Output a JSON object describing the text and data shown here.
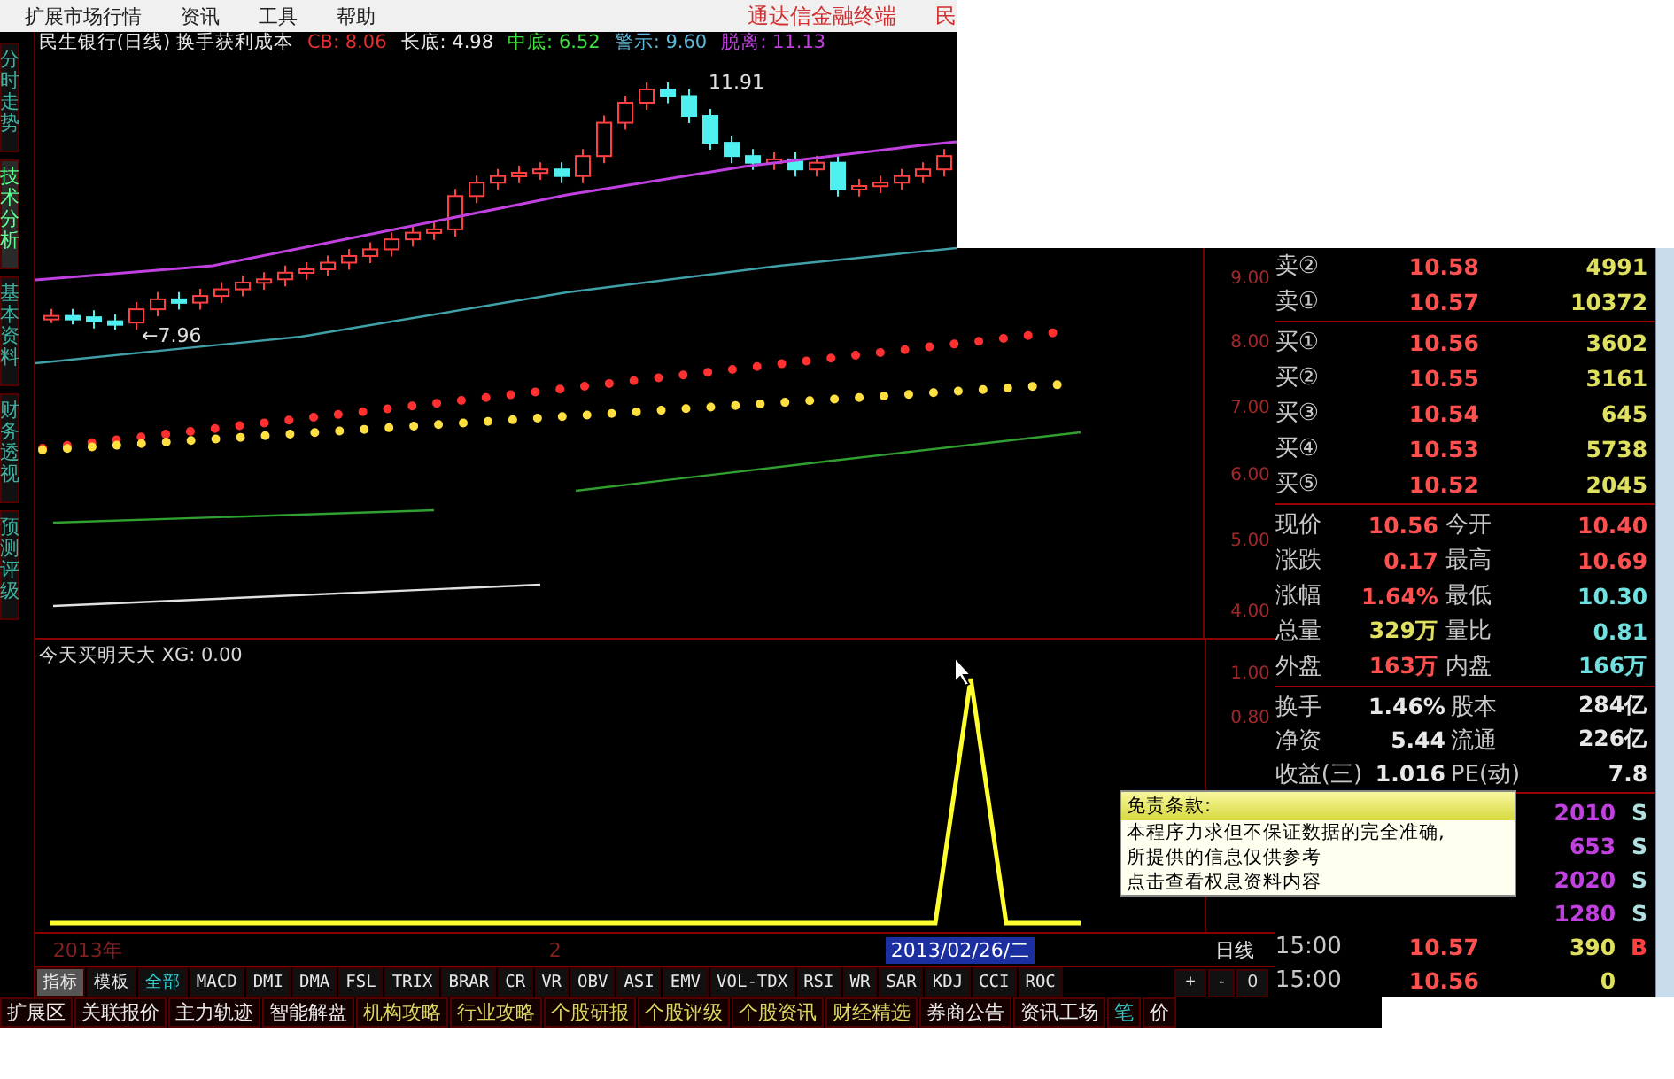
{
  "menu_bar": {
    "items": [
      "扩展市场行情",
      "资讯",
      "工具",
      "帮助"
    ],
    "brand": "通达信金融终端",
    "brand_cut": "民"
  },
  "side_tabs": [
    {
      "label": "分时走势",
      "selected": false
    },
    {
      "label": "技术分析",
      "selected": true
    },
    {
      "label": "基本资料",
      "selected": false
    },
    {
      "label": "财务透视",
      "selected": false
    },
    {
      "label": "预测评级",
      "selected": false
    }
  ],
  "chart_header": {
    "title": "民生银行(日线) 换手获利成本",
    "indicators": [
      {
        "label": "CB:",
        "value": "8.06",
        "kind": "cost"
      },
      {
        "label": "长底:",
        "value": "4.98",
        "kind": "long"
      },
      {
        "label": "中底:",
        "value": "6.52",
        "kind": "mid"
      },
      {
        "label": "警示:",
        "value": "9.60",
        "kind": "warn"
      },
      {
        "label": "脱离:",
        "value": "11.13",
        "kind": "break"
      }
    ]
  },
  "main_chart": {
    "high_marker": "11.91",
    "low_marker": "←7.96",
    "axis_labels": [
      "9.00",
      "8.00",
      "7.00",
      "6.00",
      "5.00",
      "4.00"
    ]
  },
  "lower_panel": {
    "title": "今天买明天大 XG: 0.00",
    "axis_labels": [
      "1.00",
      "0.80"
    ]
  },
  "date_bar": {
    "year": "2013年",
    "month": "2",
    "cursor_date": "2013/02/26/二",
    "period": "日线"
  },
  "indicator_tabs": [
    {
      "label": "指标",
      "selected": true,
      "kind": "mode"
    },
    {
      "label": "模板",
      "selected": false,
      "kind": "mode"
    },
    {
      "label": "全部",
      "selected": false,
      "kind": "group"
    },
    {
      "label": "MACD",
      "selected": false,
      "kind": "indicator"
    },
    {
      "label": "DMI",
      "selected": false,
      "kind": "indicator"
    },
    {
      "label": "DMA",
      "selected": false,
      "kind": "indicator"
    },
    {
      "label": "FSL",
      "selected": false,
      "kind": "indicator"
    },
    {
      "label": "TRIX",
      "selected": false,
      "kind": "indicator"
    },
    {
      "label": "BRAR",
      "selected": false,
      "kind": "indicator"
    },
    {
      "label": "CR",
      "selected": false,
      "kind": "indicator"
    },
    {
      "label": "VR",
      "selected": false,
      "kind": "indicator"
    },
    {
      "label": "OBV",
      "selected": false,
      "kind": "indicator"
    },
    {
      "label": "ASI",
      "selected": false,
      "kind": "indicator"
    },
    {
      "label": "EMV",
      "selected": false,
      "kind": "indicator"
    },
    {
      "label": "VOL-TDX",
      "selected": false,
      "kind": "indicator"
    },
    {
      "label": "RSI",
      "selected": false,
      "kind": "indicator"
    },
    {
      "label": "WR",
      "selected": false,
      "kind": "indicator"
    },
    {
      "label": "SAR",
      "selected": false,
      "kind": "indicator"
    },
    {
      "label": "KDJ",
      "selected": false,
      "kind": "indicator"
    },
    {
      "label": "CCI",
      "selected": false,
      "kind": "indicator"
    },
    {
      "label": "ROC",
      "selected": false,
      "kind": "indicator"
    }
  ],
  "zoom_buttons": [
    "+",
    "-",
    "0"
  ],
  "bottom_tabs": [
    {
      "label": "扩展区",
      "kind": "plain"
    },
    {
      "label": "关联报价",
      "kind": "plain"
    },
    {
      "label": "主力轨迹",
      "kind": "plain"
    },
    {
      "label": "智能解盘",
      "kind": "plain"
    },
    {
      "label": "机构攻略",
      "kind": "info"
    },
    {
      "label": "行业攻略",
      "kind": "info"
    },
    {
      "label": "个股研报",
      "kind": "info"
    },
    {
      "label": "个股评级",
      "kind": "info"
    },
    {
      "label": "个股资讯",
      "kind": "info"
    },
    {
      "label": "财经精选",
      "kind": "info"
    },
    {
      "label": "券商公告",
      "kind": "plain"
    },
    {
      "label": "资讯工场",
      "kind": "plain"
    },
    {
      "label": "笔",
      "kind": "view"
    },
    {
      "label": "价",
      "kind": "plain"
    }
  ],
  "order_book": {
    "asks": [
      {
        "label": "卖②",
        "price": "10.58",
        "volume": "4991"
      },
      {
        "label": "卖①",
        "price": "10.57",
        "volume": "10372"
      }
    ],
    "bids": [
      {
        "label": "买①",
        "price": "10.56",
        "volume": "3602"
      },
      {
        "label": "买②",
        "price": "10.55",
        "volume": "3161"
      },
      {
        "label": "买③",
        "price": "10.54",
        "volume": "645"
      },
      {
        "label": "买④",
        "price": "10.53",
        "volume": "5738"
      },
      {
        "label": "买⑤",
        "price": "10.52",
        "volume": "2045"
      }
    ]
  },
  "quote_stats": [
    {
      "left": {
        "label": "现价",
        "value": "10.56",
        "kind": "up"
      },
      "right": {
        "label": "今开",
        "value": "10.40",
        "kind": "up"
      }
    },
    {
      "left": {
        "label": "涨跌",
        "value": "0.17",
        "kind": "up"
      },
      "right": {
        "label": "最高",
        "value": "10.69",
        "kind": "up"
      }
    },
    {
      "left": {
        "label": "涨幅",
        "value": "1.64%",
        "kind": "up"
      },
      "right": {
        "label": "最低",
        "value": "10.30",
        "kind": "down"
      }
    },
    {
      "left": {
        "label": "总量",
        "value": "329万",
        "kind": "volume"
      },
      "right": {
        "label": "量比",
        "value": "0.81",
        "kind": "down"
      }
    },
    {
      "left": {
        "label": "外盘",
        "value": "163万",
        "kind": "up"
      },
      "right": {
        "label": "内盘",
        "value": "166万",
        "kind": "down"
      }
    }
  ],
  "fundamentals": [
    {
      "label": "换手",
      "value": "1.46%",
      "label_2": "股本",
      "value_2": "284亿"
    },
    {
      "label": "净资",
      "value": "5.44",
      "label_2": "流通",
      "value_2": "226亿"
    },
    {
      "label": "收益(三)",
      "value": "1.016",
      "label_2": "PE(动)",
      "value_2": "7.8"
    }
  ],
  "trades": [
    {
      "volume": "2010",
      "side": "S",
      "kind": "sell"
    },
    {
      "volume": "653",
      "side": "S",
      "kind": "sell"
    },
    {
      "volume": "2020",
      "side": "S",
      "kind": "sell"
    },
    {
      "volume": "1280",
      "side": "S",
      "kind": "sell"
    },
    {
      "time": "15:00",
      "price": "10.57",
      "volume": "390",
      "side": "B",
      "kind": "buy"
    },
    {
      "time": "15:00",
      "price": "10.56",
      "volume": "0",
      "kind": "none"
    }
  ],
  "tooltip": {
    "title": "免责条款:",
    "lines": [
      "本程序力求但不保证数据的完全准确,",
      "所提供的信息仅供参考",
      "点击查看权息资料内容"
    ]
  }
}
